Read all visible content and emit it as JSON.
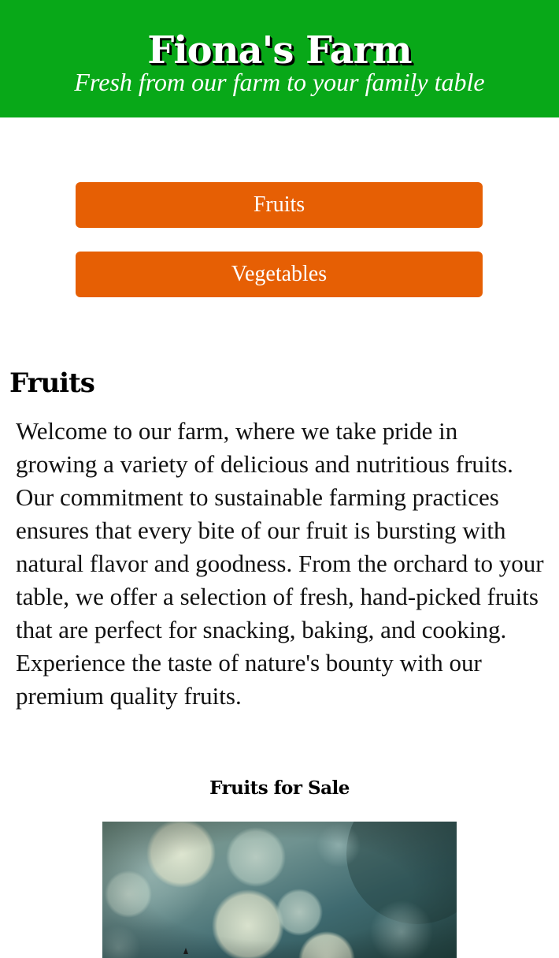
{
  "header": {
    "title": "Fiona's Farm",
    "tagline": "Fresh from our farm to your family table"
  },
  "nav": {
    "items": [
      {
        "label": "Fruits"
      },
      {
        "label": "Vegetables"
      }
    ]
  },
  "section": {
    "heading": "Fruits",
    "intro": "Welcome to our farm, where we take pride in growing a variety of delicious and nutritious fruits. Our commitment to sustainable farming practices ensures that every bite of our fruit is bursting with natural flavor and goodness. From the orchard to your table, we offer a selection of fresh, hand-picked fruits that are perfect for snacking, baking, and cooking. Experience the taste of nature's bounty with our premium quality fruits.",
    "subheading": "Fruits for Sale"
  },
  "colors": {
    "header_bg": "#08a818",
    "button_bg": "#e65f04",
    "text": "#111111"
  }
}
